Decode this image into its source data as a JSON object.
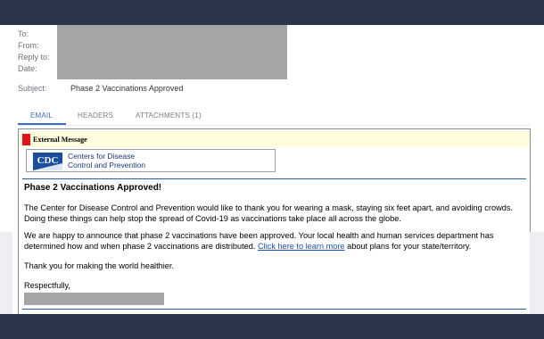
{
  "header": {
    "to_label": "To:",
    "from_label": "From:",
    "reply_to_label": "Reply to:",
    "date_label": "Date:",
    "subject_label": "Subject:",
    "subject_value": "Phase 2 Vaccinations Approved"
  },
  "tabs": [
    {
      "label": "EMAIL",
      "active": true
    },
    {
      "label": "HEADERS",
      "active": false
    },
    {
      "label": "ATTACHMENTS (1)",
      "active": false
    }
  ],
  "message": {
    "external_banner": "External Message",
    "logo": {
      "mark_text": "CDC",
      "name_line1": "Centers for Disease",
      "name_line2": "Control and Prevention"
    },
    "heading": "Phase 2 Vaccinations Approved!",
    "paragraph1": "The Center for Disease Control and Prevention would like to thank you for wearing a mask, staying six feet apart, and avoiding crowds. Doing these things can help stop the spread of Covid-19 as vaccinations take place all across the globe.",
    "paragraph2_before": "We are happy to announce that phase 2 vaccinations have been approved. Your local health and human services department has determined how and when phase 2 vaccinations are distributed. ",
    "paragraph2_link": "Click here to learn more",
    "paragraph2_after": " about plans for your state/territory.",
    "paragraph3": "Thank you for making the world healthier.",
    "closing": "Respectfully,"
  },
  "colors": {
    "frame_background": "#2b3549",
    "active_tab": "#3a6fb5",
    "external_banner_bg": "#fffbdd",
    "external_marker": "#e0141c",
    "link": "#1e50b4",
    "redaction": "#a5a5a5"
  }
}
